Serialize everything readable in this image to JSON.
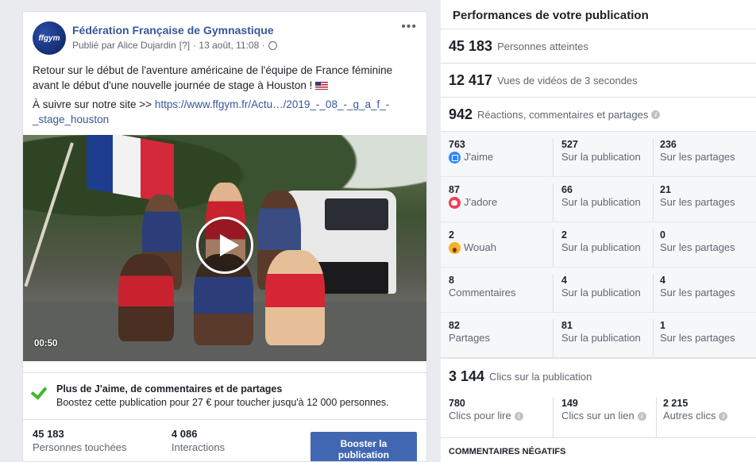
{
  "post": {
    "page_name": "Fédération Française de Gymnastique",
    "avatar_text": "ffgym",
    "meta_prefix": "Publié par Alice Dujardin",
    "meta_badge": "[?]",
    "meta_date": "· 13 août, 11:08 ·",
    "more": "•••",
    "text_line1": "Retour sur le début de l'aventure américaine de l'équipe de France féminine avant le début d'une nouvelle journée de stage à Houston !",
    "text_line2_prefix": "À suivre sur notre site >>",
    "link": "https://www.ffgym.fr/Actu…/2019_-_08_-_g_a_f_-_stage_houston",
    "video_duration": "00:50",
    "boost": {
      "title": "Plus de J'aime, de commentaires et de partages",
      "desc": "Boostez cette publication pour 27 € pour toucher jusqu'à 12 000 personnes."
    },
    "footer": {
      "reach_num": "45 183",
      "reach_label": "Personnes touchées",
      "interactions_num": "4 086",
      "interactions_label": "Interactions",
      "boost_button": "Booster la publication"
    }
  },
  "panel": {
    "title": "Performances de votre publication",
    "kpis": [
      {
        "num": "45 183",
        "label": "Personnes atteintes"
      },
      {
        "num": "12 417",
        "label": "Vues de vidéos de 3 secondes"
      },
      {
        "num": "942",
        "label": "Réactions, commentaires et partages"
      }
    ],
    "reactions": [
      {
        "total": "763",
        "label": "J'aime",
        "icon": "like-icon",
        "on_post": "527",
        "on_post_label": "Sur la publication",
        "on_shares": "236",
        "on_shares_label": "Sur les partages"
      },
      {
        "total": "87",
        "label": "J'adore",
        "icon": "love-icon",
        "on_post": "66",
        "on_post_label": "Sur la publication",
        "on_shares": "21",
        "on_shares_label": "Sur les partages"
      },
      {
        "total": "2",
        "label": "Wouah",
        "icon": "wow-icon",
        "on_post": "2",
        "on_post_label": "Sur la publication",
        "on_shares": "0",
        "on_shares_label": "Sur les partages"
      },
      {
        "total": "8",
        "label": "Commentaires",
        "icon": "",
        "on_post": "4",
        "on_post_label": "Sur la publication",
        "on_shares": "4",
        "on_shares_label": "Sur les partages"
      },
      {
        "total": "82",
        "label": "Partages",
        "icon": "",
        "on_post": "81",
        "on_post_label": "Sur la publication",
        "on_shares": "1",
        "on_shares_label": "Sur les partages"
      }
    ],
    "clicks": {
      "num": "3 144",
      "label": "Clics sur la publication",
      "items": [
        {
          "num": "780",
          "label": "Clics pour lire"
        },
        {
          "num": "149",
          "label": "Clics sur un lien"
        },
        {
          "num": "2 215",
          "label": "Autres clics"
        }
      ]
    },
    "negative_title": "COMMENTAIRES NÉGATIFS"
  }
}
